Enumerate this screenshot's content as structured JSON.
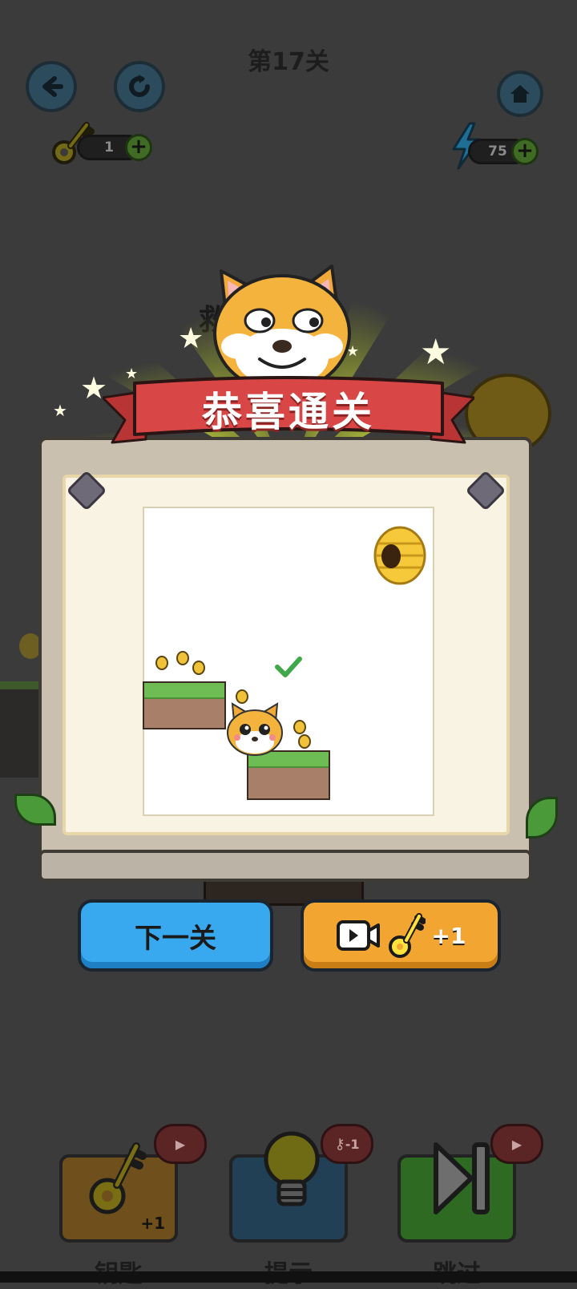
{
  "header": {
    "level_title": "第17关",
    "keys_count": "1",
    "energy_count": "75"
  },
  "background": {
    "partial_text": "救"
  },
  "popup": {
    "banner_title": "恭喜通关"
  },
  "actions": {
    "next_level_label": "下一关",
    "video_reward_label": "+1"
  },
  "tools": [
    {
      "label": "钥匙",
      "badge": "+1"
    },
    {
      "label": "提示",
      "badge": "-1"
    },
    {
      "label": "跳过",
      "badge": ""
    }
  ],
  "colors": {
    "banner_red": "#d84646",
    "next_button_blue": "#39a9ef",
    "video_button_orange": "#f2a530",
    "check_green": "#3ea84a"
  }
}
